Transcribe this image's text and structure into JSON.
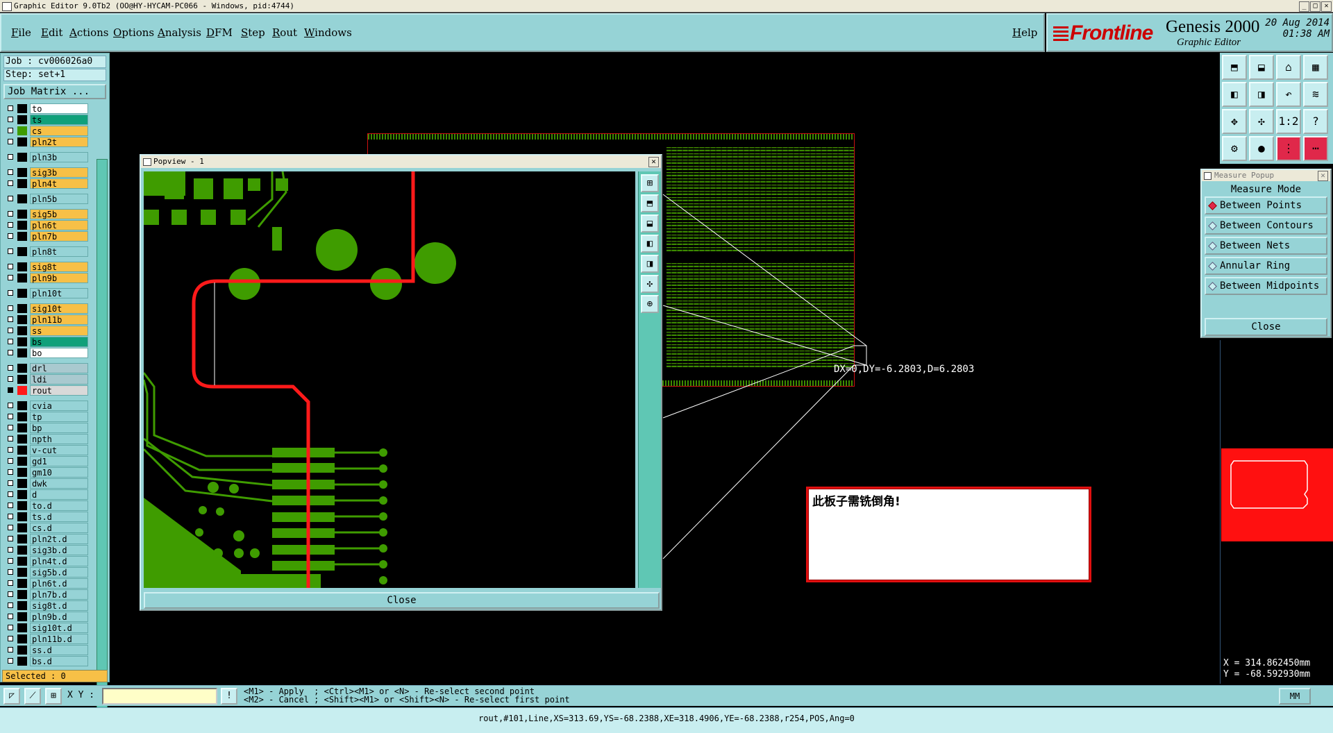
{
  "titlebar": {
    "text": "Graphic Editor 9.0Tb2 (OO@HY-HYCAM-PC066 - Windows, pid:4744)"
  },
  "menu": [
    "File",
    "Edit",
    "Actions",
    "Options",
    "Analysis",
    "DFM",
    "Step",
    "Rout",
    "Windows"
  ],
  "help": "Help",
  "brand": {
    "logo": "Frontline",
    "product": "Genesis 2000",
    "subtitle": "Graphic Editor",
    "date": "20 Aug 2014",
    "time": "01:38 AM"
  },
  "job": {
    "job_label": "Job : cv006026a0",
    "step_label": "Step: set+1",
    "matrix_button": "Job Matrix ..."
  },
  "layers": [
    {
      "name": "to",
      "color": "#ffffff",
      "swatch": "#000000"
    },
    {
      "name": "ts",
      "color": "#10a07a",
      "swatch": "#000000"
    },
    {
      "name": "cs",
      "color": "#f7c047",
      "swatch": "#3f9c00"
    },
    {
      "name": "pln2t",
      "color": "#f7c047",
      "swatch": "#000000"
    },
    {
      "name": "pln3b",
      "color": "#96d3d6",
      "swatch": "#000000"
    },
    {
      "name": "sig3b",
      "color": "#f7c047",
      "swatch": "#000000"
    },
    {
      "name": "pln4t",
      "color": "#f7c047",
      "swatch": "#000000"
    },
    {
      "name": "pln5b",
      "color": "#96d3d6",
      "swatch": "#000000"
    },
    {
      "name": "sig5b",
      "color": "#f7c047",
      "swatch": "#000000"
    },
    {
      "name": "pln6t",
      "color": "#f7c047",
      "swatch": "#000000"
    },
    {
      "name": "pln7b",
      "color": "#f7c047",
      "swatch": "#000000"
    },
    {
      "name": "pln8t",
      "color": "#96d3d6",
      "swatch": "#000000"
    },
    {
      "name": "sig8t",
      "color": "#f7c047",
      "swatch": "#000000"
    },
    {
      "name": "pln9b",
      "color": "#f7c047",
      "swatch": "#000000"
    },
    {
      "name": "pln10t",
      "color": "#96d3d6",
      "swatch": "#000000"
    },
    {
      "name": "sig10t",
      "color": "#f7c047",
      "swatch": "#000000"
    },
    {
      "name": "pln11b",
      "color": "#f7c047",
      "swatch": "#000000"
    },
    {
      "name": "ss",
      "color": "#f7c047",
      "swatch": "#000000"
    },
    {
      "name": "bs",
      "color": "#10a07a",
      "swatch": "#000000"
    },
    {
      "name": "bo",
      "color": "#ffffff",
      "swatch": "#000000"
    },
    {
      "name": "drl",
      "color": "#a9c9cf",
      "swatch": "#000000"
    },
    {
      "name": "ldi",
      "color": "#a9c9cf",
      "swatch": "#000000"
    },
    {
      "name": "rout",
      "color": "#d9d9d9",
      "swatch": "#ff1a1a"
    },
    {
      "name": "cvia",
      "color": "#96d3d6",
      "swatch": "#000000"
    },
    {
      "name": "tp",
      "color": "#96d3d6",
      "swatch": "#000000"
    },
    {
      "name": "bp",
      "color": "#96d3d6",
      "swatch": "#000000"
    },
    {
      "name": "npth",
      "color": "#96d3d6",
      "swatch": "#000000"
    },
    {
      "name": "v-cut",
      "color": "#96d3d6",
      "swatch": "#000000"
    },
    {
      "name": "gd1",
      "color": "#96d3d6",
      "swatch": "#000000"
    },
    {
      "name": "gm10",
      "color": "#96d3d6",
      "swatch": "#000000"
    },
    {
      "name": "dwk",
      "color": "#96d3d6",
      "swatch": "#000000"
    },
    {
      "name": "d",
      "color": "#96d3d6",
      "swatch": "#000000"
    },
    {
      "name": "to.d",
      "color": "#96d3d6",
      "swatch": "#000000"
    },
    {
      "name": "ts.d",
      "color": "#96d3d6",
      "swatch": "#000000"
    },
    {
      "name": "cs.d",
      "color": "#96d3d6",
      "swatch": "#000000"
    },
    {
      "name": "pln2t.d",
      "color": "#96d3d6",
      "swatch": "#000000"
    },
    {
      "name": "sig3b.d",
      "color": "#96d3d6",
      "swatch": "#000000"
    },
    {
      "name": "pln4t.d",
      "color": "#96d3d6",
      "swatch": "#000000"
    },
    {
      "name": "sig5b.d",
      "color": "#96d3d6",
      "swatch": "#000000"
    },
    {
      "name": "pln6t.d",
      "color": "#96d3d6",
      "swatch": "#000000"
    },
    {
      "name": "pln7b.d",
      "color": "#96d3d6",
      "swatch": "#000000"
    },
    {
      "name": "sig8t.d",
      "color": "#96d3d6",
      "swatch": "#000000"
    },
    {
      "name": "pln9b.d",
      "color": "#96d3d6",
      "swatch": "#000000"
    },
    {
      "name": "sig10t.d",
      "color": "#96d3d6",
      "swatch": "#000000"
    },
    {
      "name": "pln11b.d",
      "color": "#96d3d6",
      "swatch": "#000000"
    },
    {
      "name": "ss.d",
      "color": "#96d3d6",
      "swatch": "#000000"
    },
    {
      "name": "bs.d",
      "color": "#96d3d6",
      "swatch": "#000000"
    }
  ],
  "selected": "Selected : 0",
  "popview": {
    "title": "Popview - 1",
    "close": "Close"
  },
  "measure": {
    "title": "Measure Popup",
    "mode": "Measure Mode",
    "options": [
      "Between Points",
      "Between Contours",
      "Between Nets",
      "Annular Ring",
      "Between Midpoints"
    ],
    "selected_index": 0,
    "close": "Close"
  },
  "measurement_label": "DX=0,DY=-6.2803,D=6.2803",
  "note": "此板子需铣倒角!",
  "coords": {
    "x": "X = 314.862450mm",
    "y": "Y = -68.592930mm"
  },
  "bottom": {
    "xy_label": "X Y :",
    "xy_value": "",
    "hint1": "<M1> - Apply  ; <Ctrl><M1> or <N> - Re-select second point",
    "hint2": "<M2> - Cancel ; <Shift><M1> or <Shift><N> - Re-select first point",
    "units": "MM"
  },
  "status": "rout,#101,Line,XS=313.69,YS=-68.2388,XE=318.4906,YE=-68.2388,r254,POS,Ang=0",
  "colors": {
    "panel": "#96d3d6",
    "highlight": "#f7c047",
    "rout": "#ff1a1a",
    "copper": "#3f9c00"
  }
}
